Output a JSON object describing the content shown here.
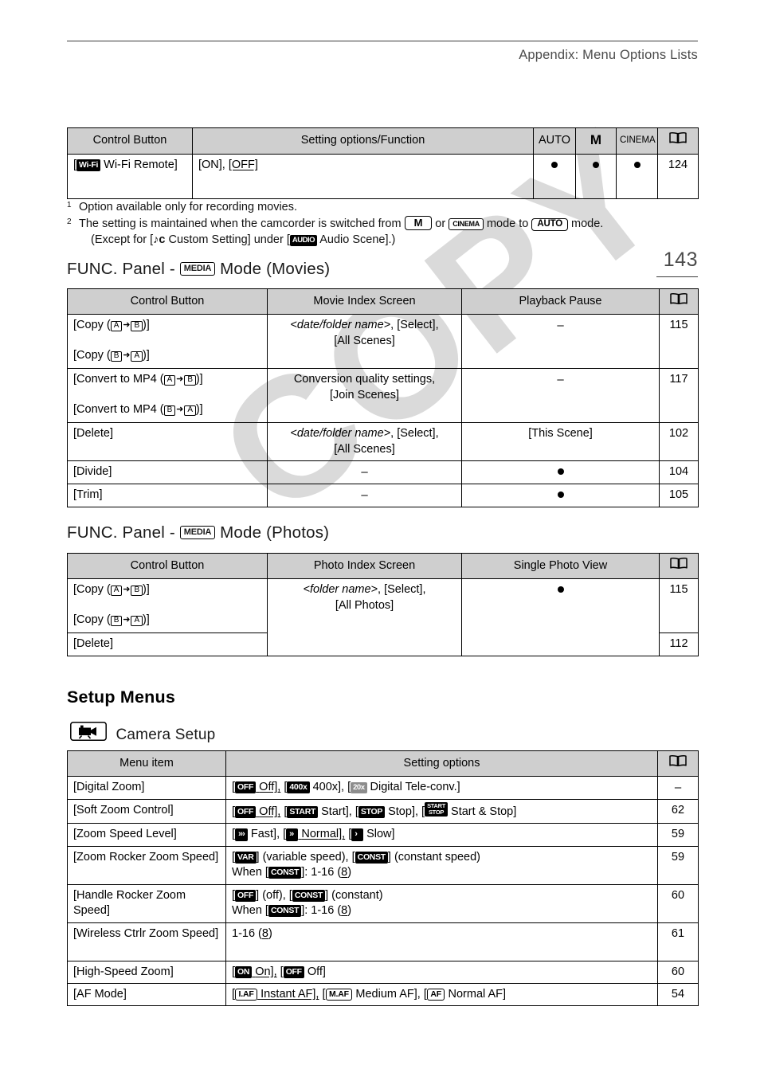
{
  "header": {
    "title": "Appendix: Menu Options Lists",
    "page_number": "143"
  },
  "top_table": {
    "columns": [
      "Control Button",
      "Setting options/Function",
      "AUTO",
      "M",
      "CINEMA",
      "book-icon"
    ],
    "rows": [
      {
        "control_prefix": "[",
        "control_badge": "Wi-Fi",
        "control_label": "Wi-Fi Remote]",
        "setting_plain": "[ON], ",
        "setting_underlined": "[OFF]",
        "auto": "●",
        "m": "●",
        "cinema": "●",
        "page": "124"
      }
    ]
  },
  "footnotes": {
    "note1_marker": "1",
    "note1_text": "Option available only for recording movies.",
    "note2_marker": "2",
    "note2_part1": "The setting is maintained when the camcorder is switched from",
    "note2_badge_m": "M",
    "note2_or": "or",
    "note2_badge_cinema": "CINEMA",
    "note2_part2": "mode to",
    "note2_badge_auto": "AUTO",
    "note2_part3": "mode.",
    "note2_line2_a": "(Except for [",
    "note2_line2_music_icon": "♪ᴄ",
    "note2_line2_b": "Custom Setting] under [",
    "note2_line2_audio_badge": "AUDIO",
    "note2_line2_c": "Audio Scene].)"
  },
  "movies_section": {
    "heading_pre": "FUNC. Panel - ",
    "heading_badge": "MEDIA",
    "heading_post": " Mode (Movies)",
    "columns": [
      "Control Button",
      "Movie Index Screen",
      "Playback Pause",
      "book-icon"
    ],
    "rows": [
      {
        "control_line1_pre": "[Copy (",
        "control_line1_a": "A",
        "control_line1_arrow": "➜",
        "control_line1_b": "B",
        "control_line1_post": ")]",
        "control_line2_pre": "[Copy (",
        "control_line2_a": "B",
        "control_line2_arrow": "➜",
        "control_line2_b": "A",
        "control_line2_post": ")]",
        "index_italic": "<date/folder name>",
        "index_rest": ", [Select],",
        "index_line2": "[All Scenes]",
        "pause": "–",
        "page": "115"
      },
      {
        "control_line1_pre": "[Convert to MP4 (",
        "control_line1_a": "A",
        "control_line1_arrow": "➜",
        "control_line1_b": "B",
        "control_line1_post": ")]",
        "control_line2_pre": "[Convert to MP4 (",
        "control_line2_a": "B",
        "control_line2_arrow": "➜",
        "control_line2_b": "A",
        "control_line2_post": ")]",
        "index_italic": "",
        "index_rest": "Conversion quality settings,",
        "index_line2": "[Join Scenes]",
        "pause": "–",
        "page": "117"
      },
      {
        "control_line1_pre": "[Delete]",
        "control_line1_a": "",
        "control_line1_arrow": "",
        "control_line1_b": "",
        "control_line1_post": "",
        "control_line2_pre": "",
        "control_line2_a": "",
        "control_line2_arrow": "",
        "control_line2_b": "",
        "control_line2_post": "",
        "index_italic": "<date/folder name>",
        "index_rest": ", [Select],",
        "index_line2": "[All Scenes]",
        "pause": "[This Scene]",
        "page": "102"
      },
      {
        "control_line1_pre": "[Divide]",
        "index_italic": "",
        "index_rest": "–",
        "index_line2": "",
        "pause": "●",
        "page": "104"
      },
      {
        "control_line1_pre": "[Trim]",
        "index_italic": "",
        "index_rest": "–",
        "index_line2": "",
        "pause": "●",
        "page": "105"
      }
    ]
  },
  "photos_section": {
    "heading_pre": "FUNC. Panel - ",
    "heading_badge": "MEDIA",
    "heading_post": " Mode (Photos)",
    "columns": [
      "Control Button",
      "Photo Index Screen",
      "Single Photo View",
      "book-icon"
    ],
    "rows": [
      {
        "control_line1_pre": "[Copy (",
        "control_line1_a": "A",
        "control_line1_arrow": "➜",
        "control_line1_b": "B",
        "control_line1_post": ")]",
        "control_line2_pre": "[Copy (",
        "control_line2_a": "B",
        "control_line2_arrow": "➜",
        "control_line2_b": "A",
        "control_line2_post": ")]",
        "index_italic": "<folder name>",
        "index_rest": ", [Select],",
        "index_line2": "[All Photos]",
        "single": "●",
        "page": "115"
      },
      {
        "control_line1_pre": "[Delete]",
        "single": "",
        "page": "112"
      }
    ]
  },
  "setup_menus": {
    "title": "Setup Menus",
    "camera_setup_label": "Camera Setup",
    "columns": [
      "Menu item",
      "Setting options",
      "book-icon"
    ],
    "rows": [
      {
        "menu_item": "[Digital Zoom]",
        "page": "–",
        "options_html_id": "digital-zoom"
      },
      {
        "menu_item": "[Soft Zoom Control]",
        "page": "62",
        "options_html_id": "soft-zoom-control"
      },
      {
        "menu_item": "[Zoom Speed Level]",
        "page": "59",
        "options_html_id": "zoom-speed-level"
      },
      {
        "menu_item": "[Zoom Rocker Zoom Speed]",
        "page": "59",
        "options_html_id": "zoom-rocker-zoom-speed"
      },
      {
        "menu_item": "[Handle Rocker Zoom Speed]",
        "page": "60",
        "options_html_id": "handle-rocker-zoom-speed"
      },
      {
        "menu_item": "[Wireless Ctrlr Zoom Speed]",
        "page": "61",
        "options_html_id": "wireless-ctrlr-zoom-speed"
      },
      {
        "menu_item": "[High-Speed Zoom]",
        "page": "60",
        "options_html_id": "high-speed-zoom"
      },
      {
        "menu_item": "[AF Mode]",
        "page": "54",
        "options_html_id": "af-mode"
      }
    ],
    "option_text": {
      "digital_zoom": {
        "b1": "OFF",
        "t1": "Off],",
        "pre": "[",
        "sep": ", [",
        "b2": "400x",
        "t2": "400x],",
        "b3": "20x",
        "t3": "Digital Tele-conv.]"
      },
      "soft_zoom": {
        "b1": "OFF",
        "t1": "Off],",
        "b2": "START",
        "t2": "Start],",
        "b3": "STOP",
        "t3": "Stop],",
        "b4a": "START",
        "b4b": "STOP",
        "t4": "Start & Stop]"
      },
      "zoom_speed_level": {
        "t1": "Fast],",
        "t2": "Normal],",
        "t3": "Slow]"
      },
      "zoom_rocker": {
        "b1": "VAR",
        "t1": "] (variable speed), [",
        "b2": "CONST",
        "t2": "] (constant speed)",
        "line2_pre": "When [",
        "line2_badge": "CONST",
        "line2_post": "]: 1-16 (",
        "line2_default": "8",
        "line2_end": ")"
      },
      "handle_rocker": {
        "b1": "OFF",
        "t1": "] (off), [",
        "b2": "CONST",
        "t2": "] (constant)",
        "line2_pre": "When [",
        "line2_badge": "CONST",
        "line2_post": "]: 1-16 (",
        "line2_default": "8",
        "line2_end": ")"
      },
      "wireless_ctrlr": {
        "pre": "1-16 (",
        "default": "8",
        "end": ")"
      },
      "high_speed_zoom": {
        "b1": "ON",
        "t1": "On],",
        "b2": "OFF",
        "t2": "Off]"
      },
      "af_mode": {
        "b1": "I.AF",
        "t1": "Instant AF],",
        "b2": "M.AF",
        "t2": "Medium AF],",
        "b3": "AF",
        "t3": "Normal AF]"
      }
    }
  },
  "watermark": {
    "text": "COPY"
  },
  "colors": {
    "header_bg": "#cfcfcf",
    "rule": "#3a3a3a",
    "text": "#000000",
    "watermark": "#d9d9d9",
    "gray_badge": "#8d8d8d"
  }
}
